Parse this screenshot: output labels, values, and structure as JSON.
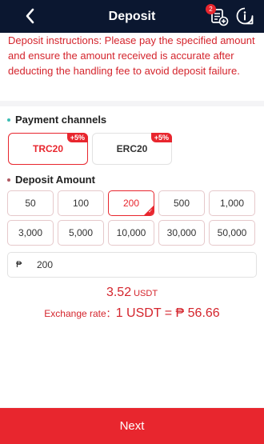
{
  "header": {
    "title": "Deposit",
    "orders_badge": "2"
  },
  "notice": {
    "text": "Deposit instructions: Please pay the specified amount and ensure the amount received is accurate after deducting the handling fee to avoid deposit failure."
  },
  "payment": {
    "title": "Payment channels",
    "channels": [
      {
        "label": "TRC20",
        "tag": "+5%",
        "selected": true
      },
      {
        "label": "ERC20",
        "tag": "+5%",
        "selected": false
      }
    ]
  },
  "deposit": {
    "title": "Deposit Amount",
    "amounts": [
      "50",
      "100",
      "200",
      "500",
      "1,000",
      "3,000",
      "5,000",
      "10,000",
      "30,000",
      "50,000"
    ],
    "selected": "200",
    "currency_symbol": "₱",
    "input_value": "200"
  },
  "result": {
    "usdt_amount": "3.52",
    "usdt_unit": "USDT",
    "rate_label": "Exchange rate：",
    "rate_value": "1 USDT = ₱ 56.66"
  },
  "footer": {
    "next_label": "Next"
  },
  "colors": {
    "header": "#0b1730",
    "accent": "#e8262e",
    "payment_dot": "#3dbdb4",
    "deposit_dot": "#b05a63"
  }
}
